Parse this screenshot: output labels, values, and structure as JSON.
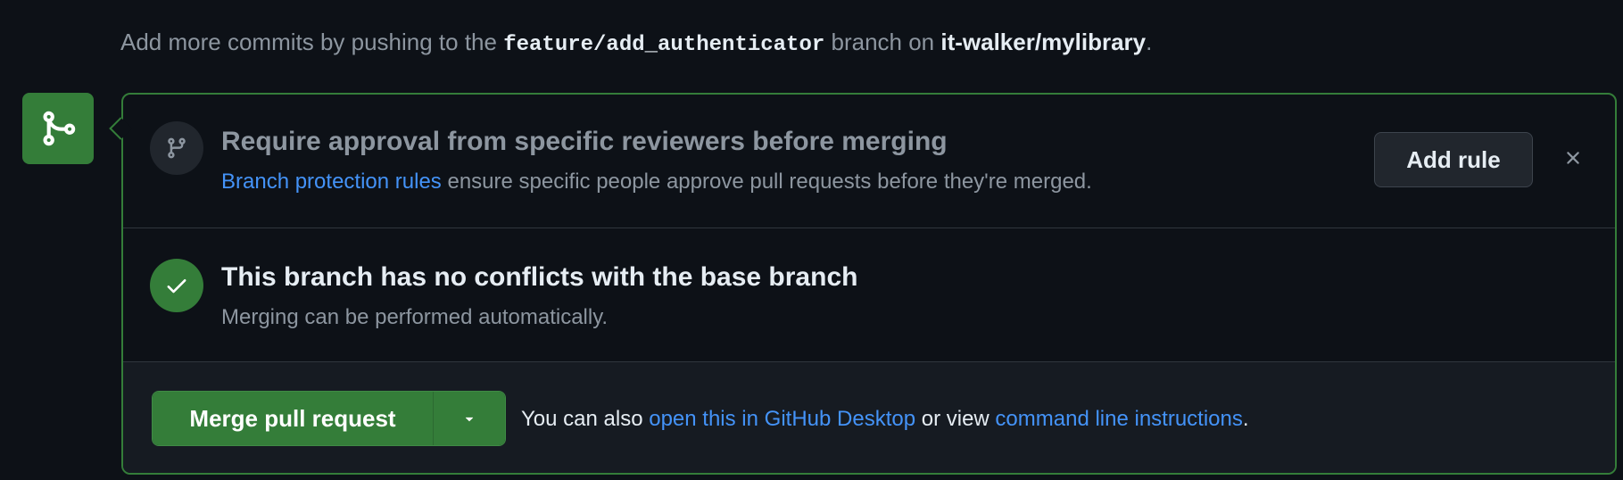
{
  "hint": {
    "prefix": "Add more commits by pushing to the ",
    "branch": "feature/add_authenticator",
    "middle": " branch on ",
    "repo": "it-walker/mylibrary",
    "suffix": "."
  },
  "merge_badge": {
    "icon": "git-merge-icon"
  },
  "approval": {
    "icon": "git-branch-icon",
    "title": "Require approval from specific reviewers before merging",
    "link_text": "Branch protection rules",
    "subtitle_rest": " ensure specific people approve pull requests before they're merged.",
    "add_rule_label": "Add rule",
    "close_icon": "close-icon"
  },
  "conflicts": {
    "icon": "check-icon",
    "title": "This branch has no conflicts with the base branch",
    "subtitle": "Merging can be performed automatically."
  },
  "merge": {
    "button_label": "Merge pull request",
    "caret_icon": "triangle-down-icon",
    "also_prefix": "You can also ",
    "desktop_link": "open this in GitHub Desktop",
    "middle": " or view ",
    "cli_link": "command line instructions",
    "suffix": "."
  },
  "colors": {
    "background": "#0d1117",
    "success": "#347d39",
    "link": "#4493f8",
    "muted": "#8d96a0"
  }
}
